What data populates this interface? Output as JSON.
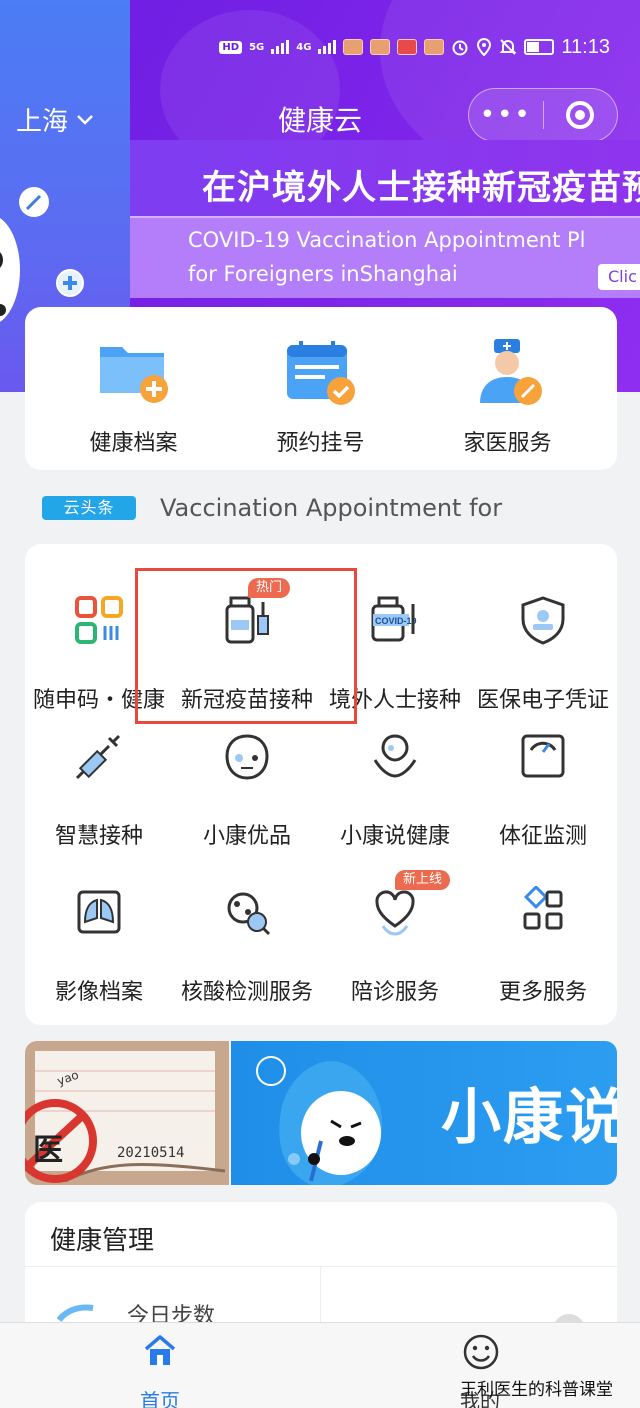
{
  "status_bar": {
    "hd_badge": "HD",
    "signal1": "5G",
    "signal2": "4G",
    "time": "11:13"
  },
  "header": {
    "city": "上海",
    "title": "健康云",
    "capsule_more": "•••"
  },
  "banner": {
    "title_cn": "在沪境外人士接种新冠疫苗预",
    "title_en_line1": "COVID-19 Vaccination Appointment Pl",
    "title_en_line2": "for Foreigners inShanghai",
    "click_label": "Clic"
  },
  "quick_services": [
    {
      "label": "健康档案",
      "icon": "folder-plus-icon"
    },
    {
      "label": "预约挂号",
      "icon": "calendar-check-icon"
    },
    {
      "label": "家医服务",
      "icon": "doctor-icon"
    }
  ],
  "headline": {
    "tag": "云头条",
    "text": "Vaccination Appointment for"
  },
  "services": [
    {
      "label": "随申码・健康",
      "icon": "qr-code-icon"
    },
    {
      "label": "新冠疫苗接种",
      "icon": "vaccine-bottle-icon",
      "badge": "热门"
    },
    {
      "label": "境外人士接种",
      "icon": "covid19-vaccine-icon"
    },
    {
      "label": "医保电子凭证",
      "icon": "shield-id-icon"
    },
    {
      "label": "智慧接种",
      "icon": "syringe-icon"
    },
    {
      "label": "小康优品",
      "icon": "mascot-face-icon"
    },
    {
      "label": "小康说健康",
      "icon": "mascot-hands-icon"
    },
    {
      "label": "体征监测",
      "icon": "scale-gauge-icon"
    },
    {
      "label": "影像档案",
      "icon": "lungs-xray-icon"
    },
    {
      "label": "核酸检测服务",
      "icon": "virus-search-icon"
    },
    {
      "label": "陪诊服务",
      "icon": "heart-hands-icon",
      "badge": "新上线"
    },
    {
      "label": "更多服务",
      "icon": "grid-more-icon"
    }
  ],
  "promo": {
    "left_small_text": "yao",
    "left_glyph": "医",
    "left_date": "20210514",
    "right_title": "小康说"
  },
  "health_management": {
    "title": "健康管理",
    "steps_label": "今日步数"
  },
  "tabbar": {
    "home": "首页",
    "me": "我的"
  },
  "watermark": "王利医生的科普课堂",
  "colors": {
    "primary_purple": "#7a22e8",
    "accent_blue": "#2a7bea",
    "badge_red": "#ec6a4f",
    "highlight_red": "#e8493a"
  }
}
